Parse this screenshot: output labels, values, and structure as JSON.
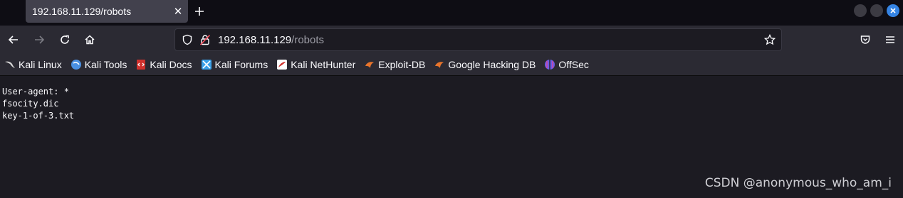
{
  "tab": {
    "title": "192.168.11.129/robots",
    "close": "✕",
    "new_tab": "+"
  },
  "window": {
    "close_icon": "×"
  },
  "url": {
    "host": "192.168.11.129",
    "path": "/robots"
  },
  "bookmarks": [
    {
      "label": "Kali Linux",
      "icon": "kali-dragon-icon",
      "color": "#cfcfcf"
    },
    {
      "label": "Kali Tools",
      "icon": "kali-tools-icon",
      "color": "#4a90e2"
    },
    {
      "label": "Kali Docs",
      "icon": "kali-docs-icon",
      "color": "#d0312d"
    },
    {
      "label": "Kali Forums",
      "icon": "kali-forums-icon",
      "color": "#3aa0e8"
    },
    {
      "label": "Kali NetHunter",
      "icon": "kali-nethunter-icon",
      "color": "#d0312d"
    },
    {
      "label": "Exploit-DB",
      "icon": "exploit-db-icon",
      "color": "#e8742b"
    },
    {
      "label": "Google Hacking DB",
      "icon": "ghdb-icon",
      "color": "#e8742b"
    },
    {
      "label": "OffSec",
      "icon": "offsec-icon",
      "color": "#6c5ce7"
    }
  ],
  "page": {
    "line1": "User-agent: *",
    "line2": "fsocity.dic",
    "line3": "key-1-of-3.txt"
  },
  "watermark": "CSDN @anonymous_who_am_i"
}
